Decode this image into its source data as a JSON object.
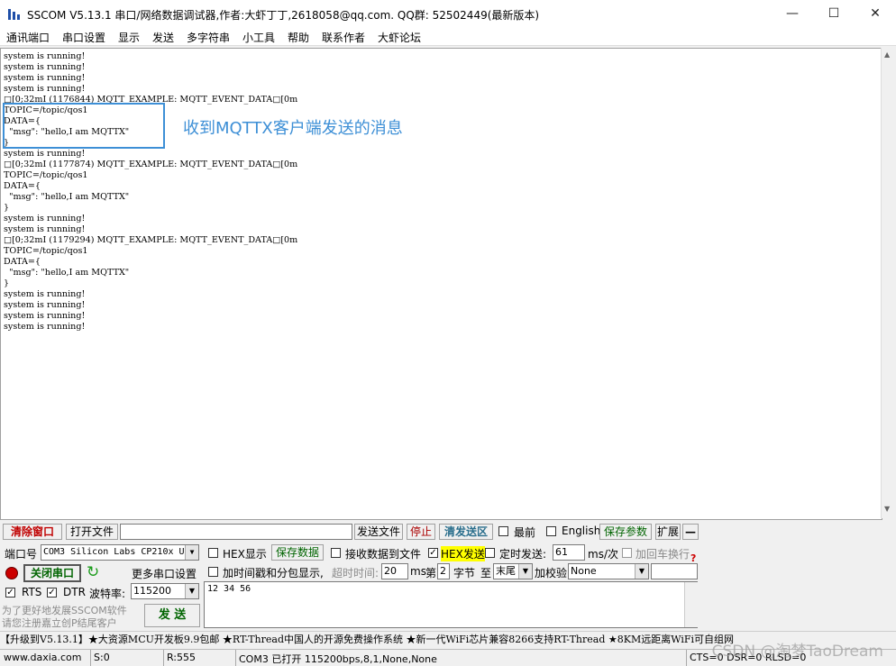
{
  "window": {
    "title": "SSCOM V5.13.1 串口/网络数据调试器,作者:大虾丁丁,2618058@qq.com. QQ群: 52502449(最新版本)",
    "minimize": "—",
    "maximize": "☐",
    "close": "✕"
  },
  "menu": [
    "通讯端口",
    "串口设置",
    "显示",
    "发送",
    "多字符串",
    "小工具",
    "帮助",
    "联系作者",
    "大虾论坛"
  ],
  "output": {
    "lines": [
      "system is running!",
      "system is running!",
      "system is running!",
      "system is running!",
      "□[0;32mI (1176844) MQTT_EXAMPLE: MQTT_EVENT_DATA□[0m",
      "TOPIC=/topic/qos1",
      "DATA={",
      "  \"msg\": \"hello,I am MQTTX\"",
      "}",
      "system is running!",
      "□[0;32mI (1177874) MQTT_EXAMPLE: MQTT_EVENT_DATA□[0m",
      "TOPIC=/topic/qos1",
      "DATA={",
      "  \"msg\": \"hello,I am MQTTX\"",
      "}",
      "system is running!",
      "system is running!",
      "□[0;32mI (1179294) MQTT_EXAMPLE: MQTT_EVENT_DATA□[0m",
      "TOPIC=/topic/qos1",
      "DATA={",
      "  \"msg\": \"hello,I am MQTTX\"",
      "}",
      "system is running!",
      "system is running!",
      "system is running!",
      "system is running!"
    ],
    "annotation": "收到MQTTX客户端发送的消息"
  },
  "toolbar": {
    "clear_window": "清除窗口",
    "open_file": "打开文件",
    "file_path": "",
    "send_file": "发送文件",
    "stop": "停止",
    "clear_send": "清发送区",
    "latest": "最前",
    "english": "English",
    "save_params": "保存参数",
    "expand": "扩展",
    "collapse": "—"
  },
  "port": {
    "port_label": "端口号",
    "port_value": "COM3 Silicon Labs CP210x U",
    "more_settings": "更多串口设置",
    "close_port": "关闭串口",
    "rts_label": "RTS",
    "dtr_label": "DTR",
    "baud_label": "波特率:",
    "baud_value": "115200",
    "promo_line1": "为了更好地发展SSCOM软件",
    "promo_line2": "请您注册嘉立创P结尾客户"
  },
  "options": {
    "hex_display": "HEX显示",
    "save_data": "保存数据",
    "recv_to_file": "接收数据到文件",
    "hex_send": "HEX发送",
    "timed_send": "定时发送:",
    "interval_value": "61",
    "interval_unit": "ms/次",
    "add_crlf": "加回车换行",
    "timestamp": "加时间戳和分包显示,",
    "timeout_label": "超时时间:",
    "timeout_value": "20",
    "timeout_unit": "ms",
    "nth_label": "第",
    "nth_value": "2",
    "byte_label": "字节",
    "to_label": "至",
    "end_value": "末尾",
    "checksum_label": "加校验",
    "checksum_value": "None",
    "question": "?"
  },
  "send": {
    "content": "12 34 56",
    "send_button": "发 送"
  },
  "promo_bar": "【升级到V5.13.1】★大资源MCU开发板9.9包邮 ★RT-Thread中国人的开源免费操作系统 ★新一代WiFi芯片兼容8266支持RT-Thread ★8KM远距离WiFi可自组网",
  "status": {
    "website": "www.daxia.com",
    "sent": "S:0",
    "received": "R:555",
    "port_state": "COM3 已打开  115200bps,8,1,None,None",
    "signals": "CTS=0 DSR=0 RLSD=0"
  },
  "watermark": "CSDN @淘梦TaoDream"
}
